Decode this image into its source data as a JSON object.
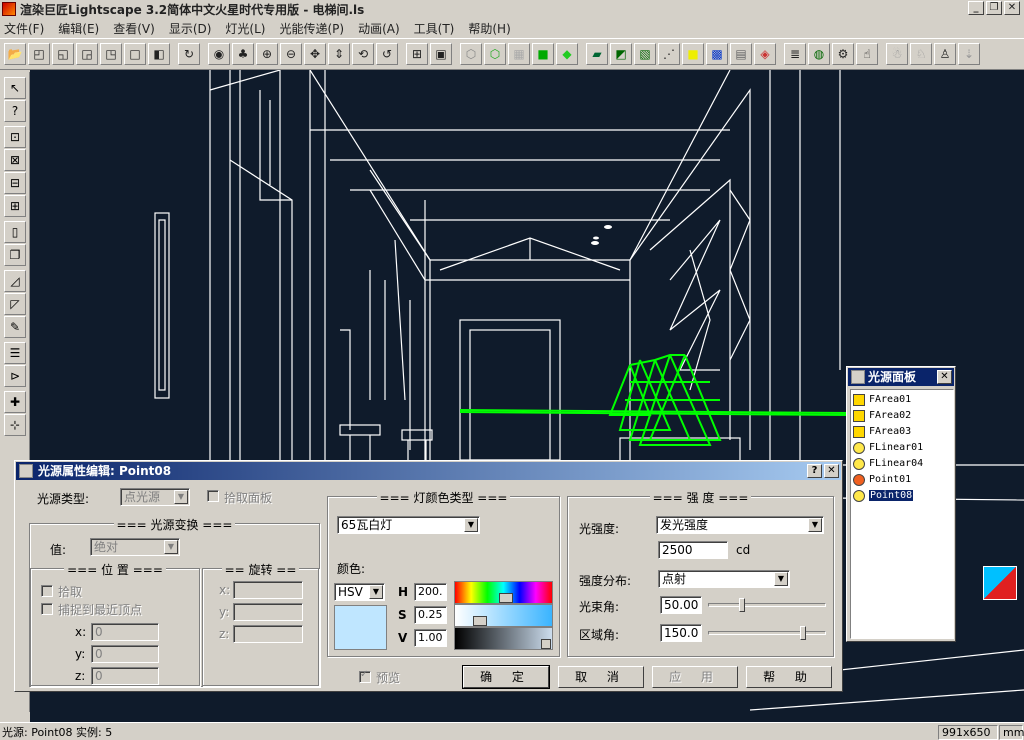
{
  "app": {
    "title": "渲染巨匠Lightscape 3.2简体中文火星时代专用版 - 电梯间.ls",
    "window_buttons": [
      "_",
      "❐",
      "✕"
    ]
  },
  "menu": [
    "文件(F)",
    "编辑(E)",
    "查看(V)",
    "显示(D)",
    "灯光(L)",
    "光能传递(P)",
    "动画(A)",
    "工具(T)",
    "帮助(H)"
  ],
  "status": {
    "left": "光源: Point08  实例: 5",
    "resolution": "991x650",
    "units": "mm"
  },
  "dialog": {
    "title": "光源属性编辑: Point08",
    "help_btn": "?",
    "close_btn": "✕",
    "light_type_label": "光源类型:",
    "light_type_value": "点光源",
    "pick_panel_label": "拾取面板",
    "transform_group": "=== 光源变换 ===",
    "value_label": "值:",
    "value_value": "绝对",
    "position_group": "=== 位 置 ===",
    "rotation_group": "== 旋转 ==",
    "pick_label": "拾取",
    "snap_label": "捕捉到最近顶点",
    "x_label": "x:",
    "y_label": "y:",
    "z_label": "z:",
    "pos_x": "0",
    "pos_y": "0",
    "pos_z": "0",
    "color_type_group": "=== 灯颜色类型 ===",
    "color_type_value": "65瓦白灯",
    "color_label": "颜色:",
    "color_model": "HSV",
    "h_label": "H",
    "s_label": "S",
    "v_label": "V",
    "h_value": "200.",
    "s_value": "0.25",
    "v_value": "1.00",
    "swatch_color": "#bfe6ff",
    "intensity_group": "=== 强 度 ===",
    "intensity_label": "光强度:",
    "intensity_mode": "发光强度",
    "intensity_value": "2500",
    "intensity_unit": "cd",
    "distribution_label": "强度分布:",
    "distribution_value": "点射",
    "beam_label": "光束角:",
    "beam_value": "50.00",
    "field_label": "区域角:",
    "field_value": "150.0",
    "preview_label": "预览",
    "ok": "确 定",
    "cancel": "取 消",
    "apply": "应 用",
    "help": "帮 助"
  },
  "light_panel": {
    "title": "光源面板",
    "close": "✕",
    "items": [
      "FArea01",
      "FArea02",
      "FArea03",
      "FLinear01",
      "FLinear04",
      "Point01",
      "Point08"
    ],
    "selected": "Point08"
  }
}
